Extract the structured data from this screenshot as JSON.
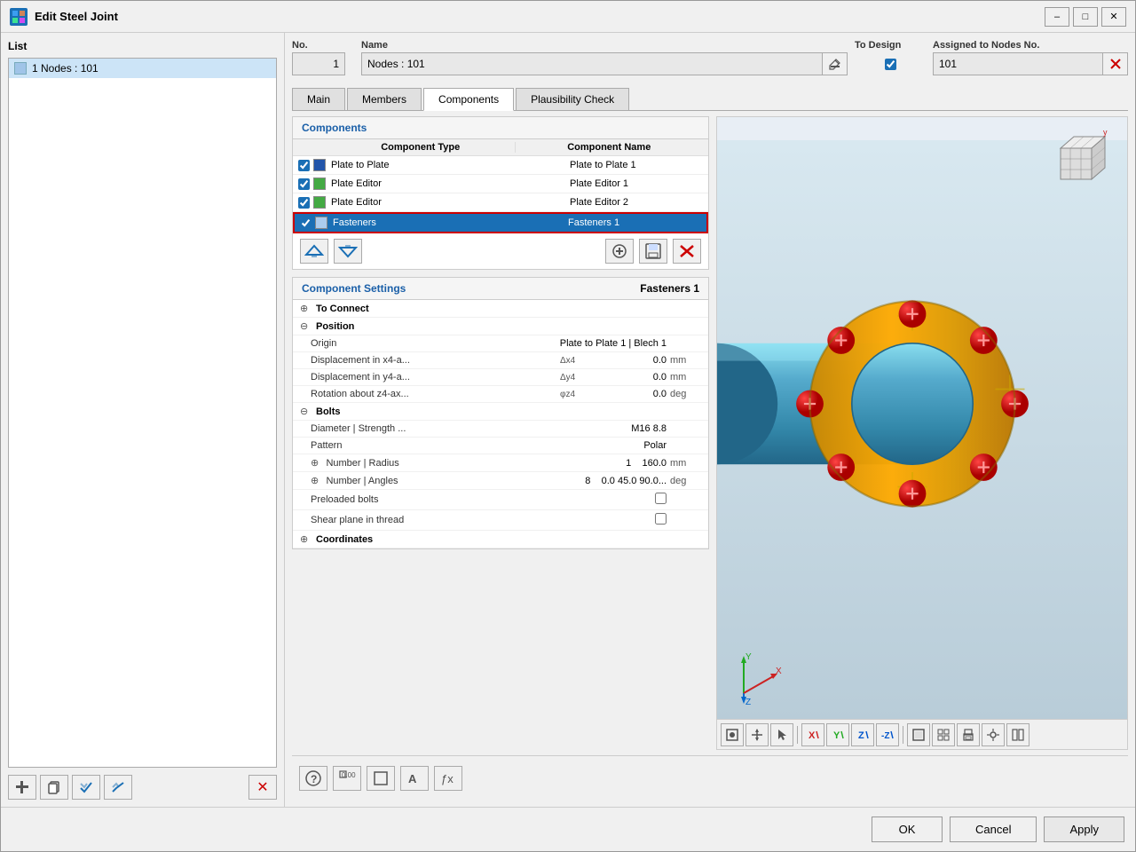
{
  "window": {
    "title": "Edit Steel Joint",
    "icon": "⚙"
  },
  "header": {
    "list_label": "List",
    "no_label": "No.",
    "no_value": "1",
    "name_label": "Name",
    "name_value": "Nodes : 101",
    "to_design_label": "To Design",
    "to_design_checked": true,
    "assigned_label": "Assigned to Nodes No.",
    "assigned_value": "101"
  },
  "tabs": [
    {
      "id": "main",
      "label": "Main",
      "active": false
    },
    {
      "id": "members",
      "label": "Members",
      "active": false
    },
    {
      "id": "components",
      "label": "Components",
      "active": true
    },
    {
      "id": "plausibility",
      "label": "Plausibility Check",
      "active": false
    }
  ],
  "list": {
    "items": [
      {
        "id": 1,
        "label": "1   Nodes : 101",
        "selected": true
      }
    ]
  },
  "components": {
    "section_title": "Components",
    "col_type": "Component Type",
    "col_name": "Component Name",
    "rows": [
      {
        "checked": true,
        "color": "blue",
        "type": "Plate to Plate",
        "name": "Plate to Plate 1",
        "selected": false
      },
      {
        "checked": true,
        "color": "green",
        "type": "Plate Editor",
        "name": "Plate Editor 1",
        "selected": false
      },
      {
        "checked": true,
        "color": "green",
        "type": "Plate Editor",
        "name": "Plate Editor 2",
        "selected": false
      },
      {
        "checked": true,
        "color": "lightblue",
        "type": "Fasteners",
        "name": "Fasteners 1",
        "selected": true
      }
    ]
  },
  "component_settings": {
    "title": "Component Settings",
    "active_name": "Fasteners 1",
    "to_connect_label": "To Connect",
    "position_label": "Position",
    "origin_label": "Origin",
    "origin_value": "Plate to Plate 1 | Blech 1",
    "disp_x4_label": "Displacement in x4-a...",
    "disp_x4_symbol": "Δx4",
    "disp_x4_value": "0.0",
    "disp_x4_unit": "mm",
    "disp_y4_label": "Displacement in y4-a...",
    "disp_y4_symbol": "Δy4",
    "disp_y4_value": "0.0",
    "disp_y4_unit": "mm",
    "rot_z4_label": "Rotation about z4-ax...",
    "rot_z4_symbol": "φz4",
    "rot_z4_value": "0.0",
    "rot_z4_unit": "deg",
    "bolts_label": "Bolts",
    "diam_label": "Diameter | Strength ...",
    "diam_value": "M16",
    "strength_value": "8.8",
    "pattern_label": "Pattern",
    "pattern_value": "Polar",
    "number_radius_label": "Number | Radius",
    "number_radius_num": "1",
    "number_radius_val": "160.0",
    "number_radius_unit": "mm",
    "number_angles_label": "Number | Angles",
    "number_angles_num": "8",
    "number_angles_val": "0.0 45.0 90.0...",
    "number_angles_unit": "deg",
    "preloaded_label": "Preloaded bolts",
    "shear_label": "Shear plane in thread",
    "coordinates_label": "Coordinates"
  },
  "footer": {
    "ok_label": "OK",
    "cancel_label": "Cancel",
    "apply_label": "Apply"
  },
  "bottom_icons": [
    "help-icon",
    "number-icon",
    "square-icon",
    "text-icon",
    "formula-icon"
  ],
  "viewport_toolbar": [
    "render-icon",
    "move-icon",
    "select-icon",
    "arrow-x-icon",
    "arrow-y-icon",
    "arrow-z-icon",
    "arrow-z2-icon",
    "view1-icon",
    "view2-icon",
    "print-icon",
    "settings-icon",
    "panel-icon"
  ],
  "colors": {
    "accent_blue": "#1a6fb5",
    "selected_blue": "#1a6fb5",
    "border": "#aaa",
    "section_title": "#1a5fa8"
  }
}
